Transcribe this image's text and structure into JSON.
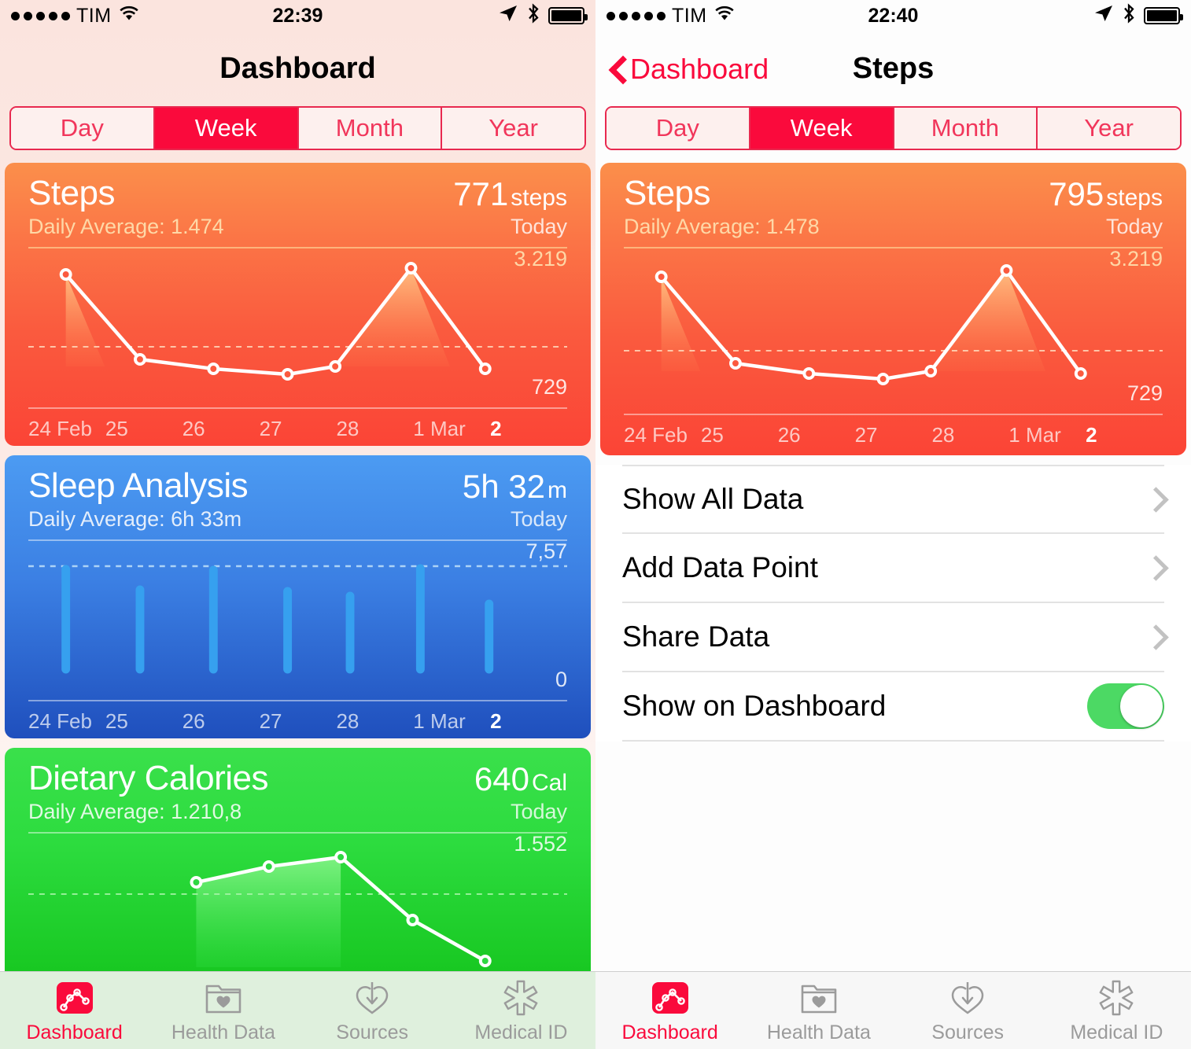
{
  "theme": {
    "accent": "#fa0a3c",
    "steps_orange_top": "#fb8f4b",
    "steps_orange_bottom": "#fb4436",
    "sleep_blue_top": "#4c9bf2",
    "sleep_blue_bottom": "#1f4fbd",
    "diet_green_top": "#3ae04b",
    "diet_green_bottom": "#16c61f",
    "toggle_green": "#4cd964"
  },
  "left": {
    "status": {
      "carrier": "TIM",
      "time": "22:39",
      "signal_dots": 5,
      "icons": [
        "location-arrow-icon",
        "bluetooth-icon",
        "battery-icon"
      ]
    },
    "nav": {
      "title": "Dashboard"
    },
    "segmented": {
      "options": [
        "Day",
        "Week",
        "Month",
        "Year"
      ],
      "selected": "Week"
    },
    "cards": [
      {
        "id": "steps",
        "title": "Steps",
        "subtitle": "Daily Average: 1.474",
        "value": "771",
        "unit": "steps",
        "period": "Today"
      },
      {
        "id": "sleep",
        "title": "Sleep Analysis",
        "subtitle": "Daily Average: 6h 33m",
        "value": "5h 32",
        "unit": "m",
        "period": "Today"
      },
      {
        "id": "diet",
        "title": "Dietary Calories",
        "subtitle": "Daily Average: 1.210,8",
        "value": "640",
        "unit": "Cal",
        "period": "Today"
      }
    ],
    "tabs": [
      {
        "label": "Dashboard",
        "icon": "dashboard-chart-icon",
        "active": true
      },
      {
        "label": "Health Data",
        "icon": "folder-heart-icon",
        "active": false
      },
      {
        "label": "Sources",
        "icon": "heart-download-icon",
        "active": false
      },
      {
        "label": "Medical ID",
        "icon": "star-of-life-icon",
        "active": false
      }
    ]
  },
  "right": {
    "status": {
      "carrier": "TIM",
      "time": "22:40",
      "signal_dots": 5,
      "icons": [
        "location-arrow-icon",
        "bluetooth-icon",
        "battery-icon"
      ]
    },
    "nav": {
      "back_label": "Dashboard",
      "title": "Steps"
    },
    "segmented": {
      "options": [
        "Day",
        "Week",
        "Month",
        "Year"
      ],
      "selected": "Week"
    },
    "card": {
      "id": "steps",
      "title": "Steps",
      "subtitle": "Daily Average: 1.478",
      "value": "795",
      "unit": "steps",
      "period": "Today"
    },
    "rows": [
      {
        "label": "Show All Data",
        "accessory": "chevron-right-icon"
      },
      {
        "label": "Add Data Point",
        "accessory": "chevron-right-icon"
      },
      {
        "label": "Share Data",
        "accessory": "chevron-right-icon"
      },
      {
        "label": "Show on Dashboard",
        "accessory": "toggle-switch",
        "toggle_on": true
      }
    ],
    "tabs": [
      {
        "label": "Dashboard",
        "icon": "dashboard-chart-icon",
        "active": true
      },
      {
        "label": "Health Data",
        "icon": "folder-heart-icon",
        "active": false
      },
      {
        "label": "Sources",
        "icon": "heart-download-icon",
        "active": false
      },
      {
        "label": "Medical ID",
        "icon": "star-of-life-icon",
        "active": false
      }
    ]
  },
  "chart_data": [
    {
      "id": "steps-left",
      "type": "line",
      "title": "Steps",
      "categories": [
        "24 Feb",
        "25",
        "26",
        "27",
        "28",
        "1 Mar",
        "2"
      ],
      "values": [
        2860,
        1430,
        1170,
        1050,
        1200,
        3219,
        1180
      ],
      "ylim": [
        729,
        3219
      ],
      "ymax_label": "3.219",
      "ymin_label": "729",
      "average_line": 1474,
      "today_index": 6,
      "grid": false,
      "legend": "none"
    },
    {
      "id": "sleep-left",
      "type": "bar",
      "title": "Sleep Analysis",
      "categories": [
        "24 Feb",
        "25",
        "26",
        "27",
        "28",
        "1 Mar",
        "2"
      ],
      "values": [
        7.57,
        6.6,
        7.55,
        6.5,
        6.3,
        7.57,
        5.9
      ],
      "ylim": [
        0,
        7.57
      ],
      "ymax_label": "7,57",
      "ymin_label": "0",
      "today_index": 6,
      "grid": false,
      "legend": "none"
    },
    {
      "id": "diet-left",
      "type": "area",
      "title": "Dietary Calories",
      "categories": [
        "24 Feb",
        "25",
        "26",
        "27",
        "28",
        "1 Mar",
        "2"
      ],
      "values": [
        null,
        null,
        1190,
        1330,
        1430,
        850,
        400
      ],
      "ylim": [
        0,
        1552
      ],
      "ymax_label": "1.552",
      "average_line": 1210.8,
      "today_index": 6,
      "grid": false,
      "legend": "none"
    },
    {
      "id": "steps-right",
      "type": "line",
      "title": "Steps",
      "categories": [
        "24 Feb",
        "25",
        "26",
        "27",
        "28",
        "1 Mar",
        "2"
      ],
      "values": [
        2860,
        1430,
        1170,
        1050,
        1200,
        3219,
        1180
      ],
      "ylim": [
        729,
        3219
      ],
      "ymax_label": "3.219",
      "ymin_label": "729",
      "average_line": 1478,
      "today_index": 6,
      "grid": false,
      "legend": "none"
    }
  ]
}
